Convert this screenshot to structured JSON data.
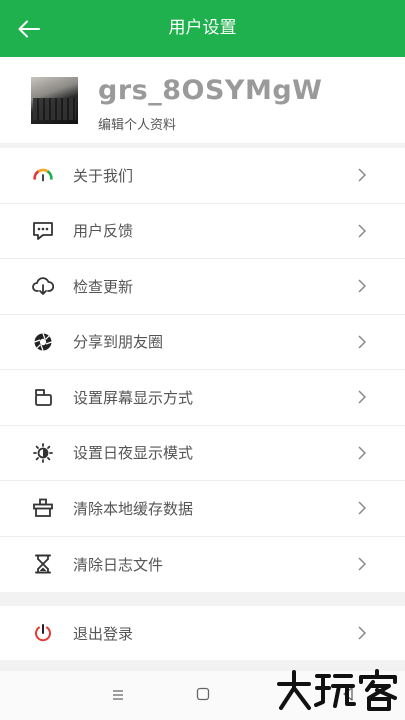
{
  "header": {
    "title": "用户设置",
    "back_icon": "arrow-left-icon"
  },
  "profile": {
    "username": "grs_8OSYMgW",
    "edit_label": "编辑个人资料"
  },
  "menu": {
    "items": [
      {
        "label": "关于我们",
        "icon": "speedometer-icon"
      },
      {
        "label": "用户反馈",
        "icon": "chat-bubble-icon"
      },
      {
        "label": "检查更新",
        "icon": "cloud-download-icon"
      },
      {
        "label": "分享到朋友圈",
        "icon": "aperture-icon"
      },
      {
        "label": "设置屏幕显示方式",
        "icon": "screen-rotate-icon"
      },
      {
        "label": "设置日夜显示模式",
        "icon": "brightness-icon"
      },
      {
        "label": "清除本地缓存数据",
        "icon": "eraser-icon"
      },
      {
        "label": "清除日志文件",
        "icon": "hourglass-icon"
      }
    ]
  },
  "logout": {
    "label": "退出登录",
    "icon": "power-icon"
  },
  "watermark": "大玩客",
  "colors": {
    "brand": "#1fb14d",
    "text": "#555555",
    "username": "#9a9a9a",
    "power": "#e53935"
  }
}
